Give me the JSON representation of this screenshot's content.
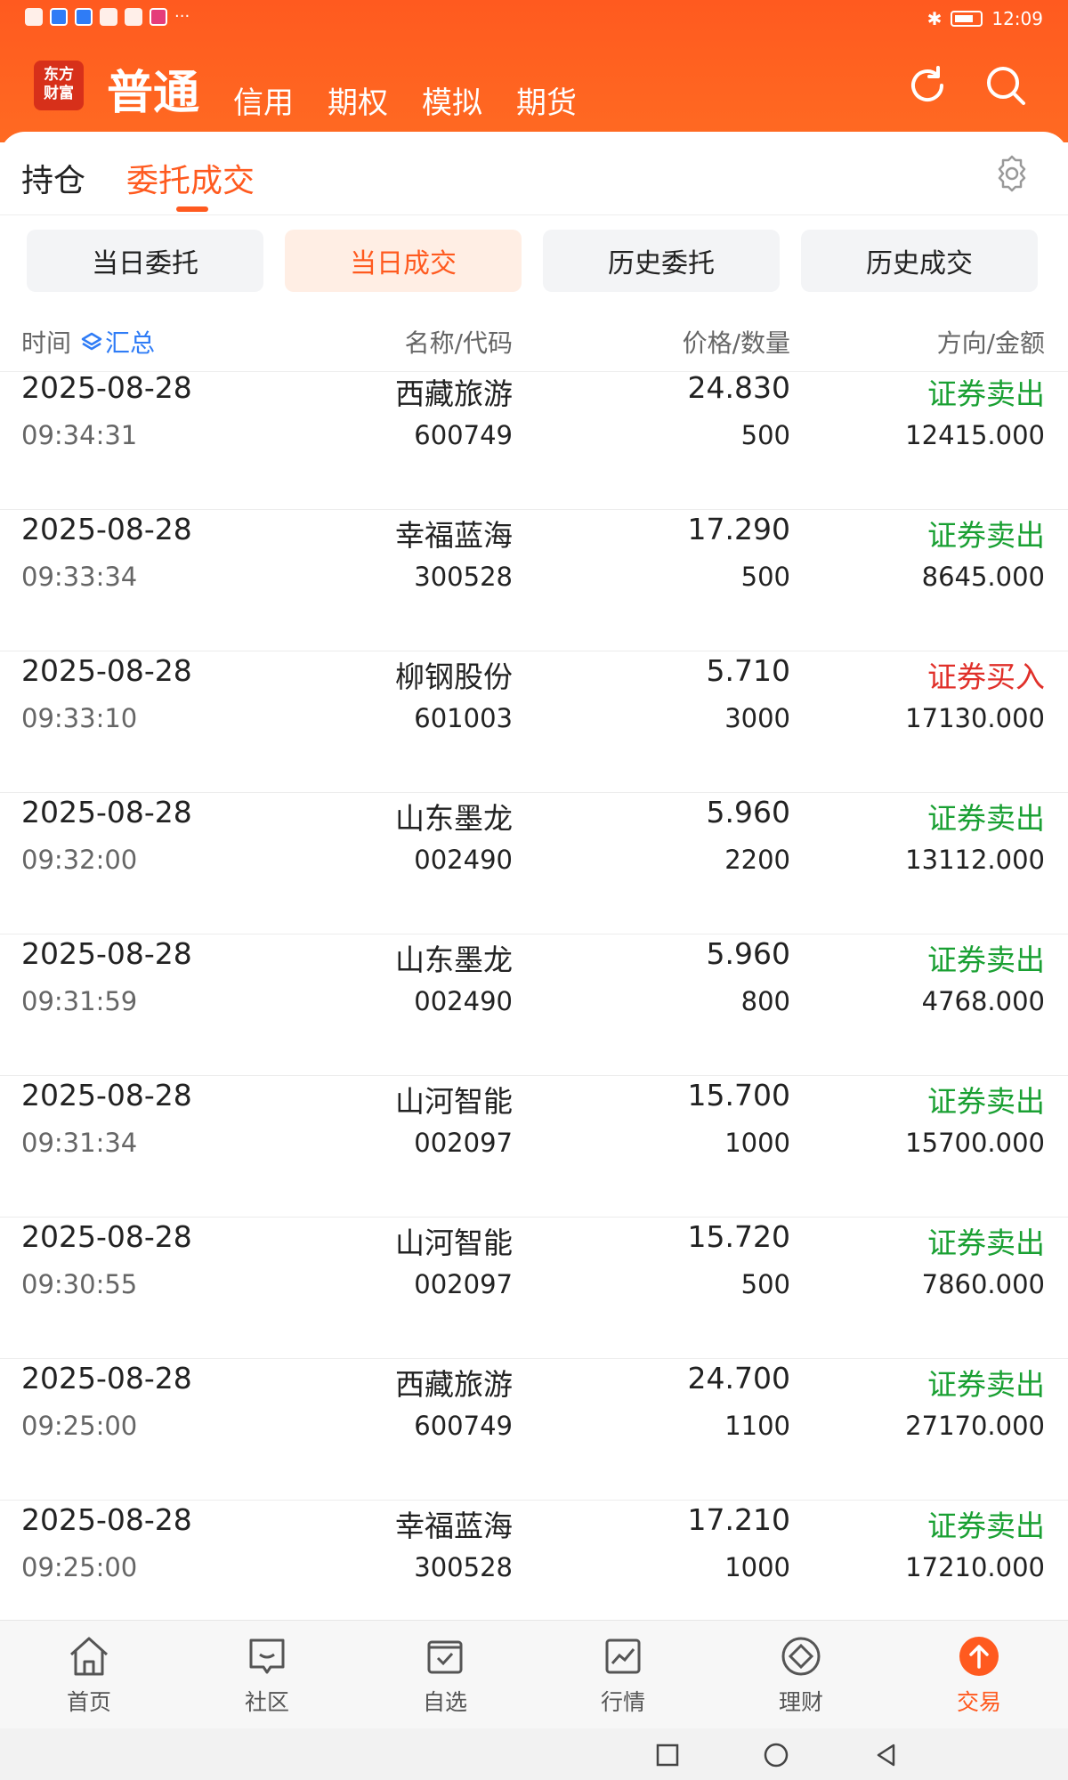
{
  "status_bar": {
    "time": "12:09",
    "overflow": "···"
  },
  "logo": {
    "line1": "东方",
    "line2": "财富"
  },
  "account_tabs": [
    "普通",
    "信用",
    "期权",
    "模拟",
    "期货"
  ],
  "sub_tabs": {
    "positions": "持仓",
    "orders": "委托成交"
  },
  "filters": [
    "当日委托",
    "当日成交",
    "历史委托",
    "历史成交"
  ],
  "columns": {
    "time": "时间",
    "summary": "汇总",
    "name_code": "名称/代码",
    "price_qty": "价格/数量",
    "dir_amount": "方向/金额"
  },
  "rows": [
    {
      "date": "2025-08-28",
      "time": "09:34:31",
      "name": "西藏旅游",
      "code": "600749",
      "price": "24.830",
      "qty": "500",
      "direction": "证券卖出",
      "amount": "12415.000"
    },
    {
      "date": "2025-08-28",
      "time": "09:33:34",
      "name": "幸福蓝海",
      "code": "300528",
      "price": "17.290",
      "qty": "500",
      "direction": "证券卖出",
      "amount": "8645.000"
    },
    {
      "date": "2025-08-28",
      "time": "09:33:10",
      "name": "柳钢股份",
      "code": "601003",
      "price": "5.710",
      "qty": "3000",
      "direction": "证券买入",
      "amount": "17130.000"
    },
    {
      "date": "2025-08-28",
      "time": "09:32:00",
      "name": "山东墨龙",
      "code": "002490",
      "price": "5.960",
      "qty": "2200",
      "direction": "证券卖出",
      "amount": "13112.000"
    },
    {
      "date": "2025-08-28",
      "time": "09:31:59",
      "name": "山东墨龙",
      "code": "002490",
      "price": "5.960",
      "qty": "800",
      "direction": "证券卖出",
      "amount": "4768.000"
    },
    {
      "date": "2025-08-28",
      "time": "09:31:34",
      "name": "山河智能",
      "code": "002097",
      "price": "15.700",
      "qty": "1000",
      "direction": "证券卖出",
      "amount": "15700.000"
    },
    {
      "date": "2025-08-28",
      "time": "09:30:55",
      "name": "山河智能",
      "code": "002097",
      "price": "15.720",
      "qty": "500",
      "direction": "证券卖出",
      "amount": "7860.000"
    },
    {
      "date": "2025-08-28",
      "time": "09:25:00",
      "name": "西藏旅游",
      "code": "600749",
      "price": "24.700",
      "qty": "1100",
      "direction": "证券卖出",
      "amount": "27170.000"
    },
    {
      "date": "2025-08-28",
      "time": "09:25:00",
      "name": "幸福蓝海",
      "code": "300528",
      "price": "17.210",
      "qty": "1000",
      "direction": "证券卖出",
      "amount": "17210.000"
    }
  ],
  "bottom_nav": [
    "首页",
    "社区",
    "自选",
    "行情",
    "理财",
    "交易"
  ],
  "colors": {
    "brand": "#ff5a1f",
    "sell": "#1aa033",
    "buy": "#e0302a",
    "link": "#2f7cf6"
  }
}
